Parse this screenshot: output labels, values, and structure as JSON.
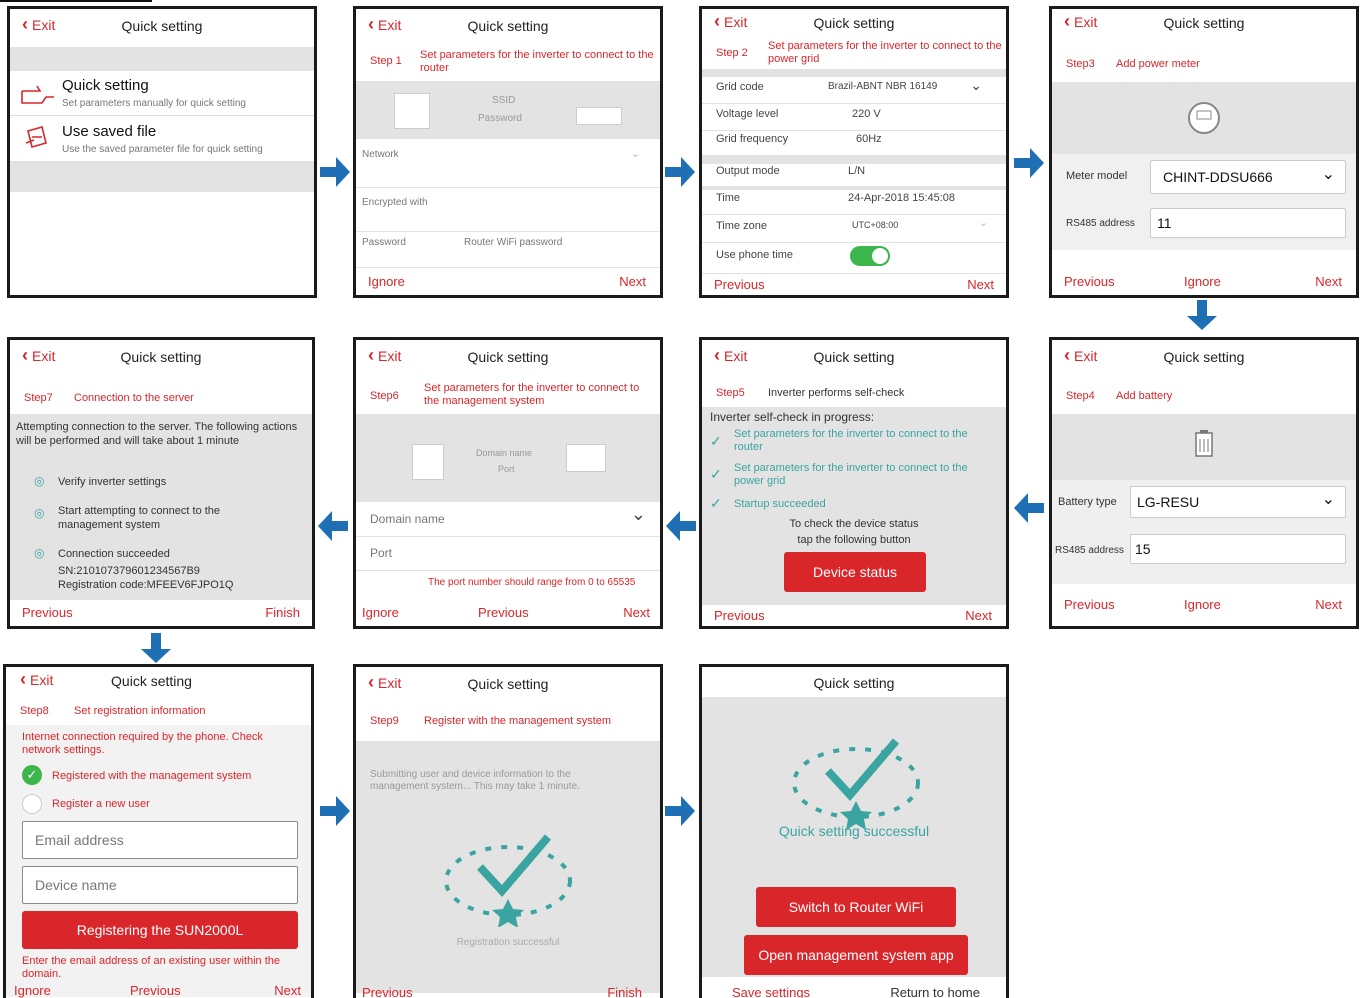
{
  "common": {
    "title": "Quick setting",
    "exit": "Exit",
    "next": "Next",
    "previous": "Previous",
    "ignore": "Ignore",
    "finish": "Finish"
  },
  "s1": {
    "opt1_title": "Quick setting",
    "opt1_sub": "Set parameters manually for quick setting",
    "opt2_title": "Use saved file",
    "opt2_sub": "Use the saved parameter file for quick setting"
  },
  "s2": {
    "step": "Step 1",
    "desc": "Set parameters for the inverter to connect to the router",
    "ssid": "SSID",
    "password_label": "Password",
    "network": "Network",
    "encrypted": "Encrypted with",
    "password": "Password",
    "password_placeholder": "Router WiFi password"
  },
  "s3": {
    "step": "Step 2",
    "desc": "Set parameters for the inverter to connect to the power grid",
    "rows": [
      {
        "label": "Grid code",
        "value": "Brazil-ABNT NBR 16149"
      },
      {
        "label": "Voltage level",
        "value": "220  V"
      },
      {
        "label": "Grid frequency",
        "value": "60Hz"
      },
      {
        "label": "Output mode",
        "value": "L/N"
      },
      {
        "label": "Time",
        "value": "24-Apr-2018 15:45:08"
      },
      {
        "label": "Time zone",
        "value": "UTC+08:00"
      },
      {
        "label": "Use phone time",
        "value": ""
      }
    ]
  },
  "s4": {
    "step": "Step3",
    "desc": "Add power meter",
    "meter_model_label": "Meter model",
    "meter_model": "CHINT-DDSU666",
    "rs485_label": "RS485 address",
    "rs485": "11"
  },
  "s5": {
    "step": "Step7",
    "desc": "Connection to the server",
    "intro": "Attempting connection to the server. The following actions will be performed and will take about 1 minute",
    "item1": "Verify inverter settings",
    "item2": "Start attempting to connect to the management system",
    "item3": "Connection succeeded",
    "sn": "SN:210107379601234567B9",
    "reg": "Registration code:MFEEV6FJPO1Q"
  },
  "s6": {
    "step": "Step6",
    "desc": "Set parameters for the inverter to connect to the management system",
    "domain_label": "Domain name",
    "port_label": "Port",
    "domain": "Domain name",
    "port": "Port",
    "hint": "The port number should range from 0 to 65535"
  },
  "s7": {
    "step": "Step5",
    "desc": "Inverter performs self-check",
    "progress": "Inverter self-check in progress:",
    "c1": "Set parameters for the inverter to connect to the router",
    "c2": "Set parameters for the inverter to connect to the power grid",
    "c3": "Startup succeeded",
    "check1": "To check the device status",
    "check2": "tap the following button",
    "btn": "Device status"
  },
  "s8": {
    "step": "Step4",
    "desc": "Add battery",
    "battery_label": "Battery type",
    "battery": "LG-RESU",
    "rs485_label": "RS485 address",
    "rs485": "15"
  },
  "s9": {
    "step": "Step8",
    "desc": "Set registration information",
    "notice": "Internet connection required by the phone. Check network settings.",
    "opt1": "Registered with the management system",
    "opt2": "Register a new user",
    "email": "Email address",
    "device": "Device name",
    "btn": "Registering the SUN2000L",
    "hint": "Enter the email address of an existing user within the domain."
  },
  "s10": {
    "step": "Step9",
    "desc": "Register with the management system",
    "submitting": "Submitting user and device information to the management system... This may take 1 minute.",
    "success": "Registration successful"
  },
  "s11": {
    "success": "Quick setting successful",
    "btn1": "Switch to Router WiFi",
    "btn2": "Open management system app",
    "save": "Save settings",
    "home": "Return to home"
  },
  "colors": {
    "accent": "#d9262b",
    "arrow": "#1f6fb5",
    "success": "#3aa5a0",
    "toggle": "#3cb54a"
  }
}
